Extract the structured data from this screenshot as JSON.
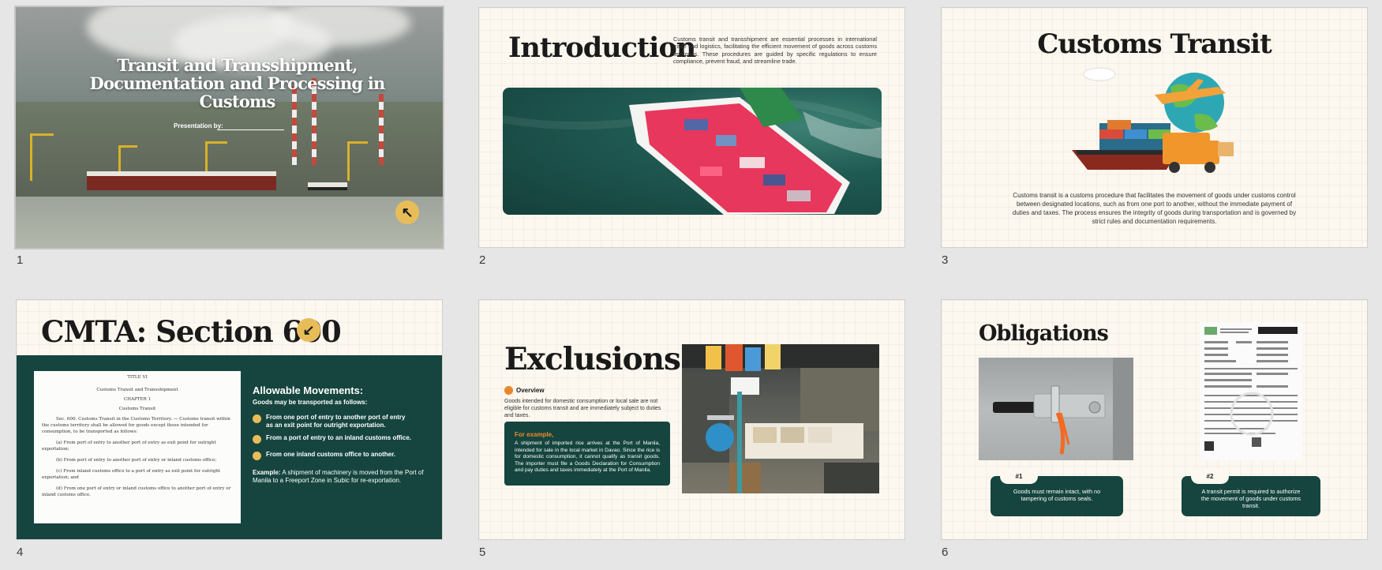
{
  "slides": [
    {
      "number": "1",
      "title": "Transit and Transshipment, Documentation and Processing in Customs",
      "presented_by": "Presentation by:",
      "icon": "arrow-up-left-icon"
    },
    {
      "number": "2",
      "title": "Introduction",
      "body": "Customs transit and transshipment are essential processes in international trade and logistics, facilitating the efficient movement of goods across customs territories. These procedures are guided by specific regulations to ensure compliance, prevent fraud, and streamline trade."
    },
    {
      "number": "3",
      "title": "Customs Transit",
      "body": "Customs transit is a customs procedure that facilitates the movement of goods under customs control between designated locations, such as from one port to another, without the immediate payment of duties and taxes. The process ensures the integrity of goods during transportation and is governed by strict rules and documentation requirements."
    },
    {
      "number": "4",
      "title": "CMTA: Section 600",
      "icon": "arrow-down-left-icon",
      "doc": {
        "title": "TITLE VI",
        "subtitle": "Customs Transit and Transshipment",
        "chapter": "CHAPTER 1",
        "chapter_name": "Customs Transit",
        "sec": "Sec. 600. Customs Transit in the Customs Territory. — Customs transit within the customs territory shall be allowed for goods except those intended for consumption, to be transported as follows:",
        "a": "(a) From port of entry to another port of entry as exit point for outright exportation;",
        "b": "(b) From port of entry to another port of entry or inland customs office;",
        "c": "(c) From inland customs office to a port of entry as exit point for outright exportation; and",
        "d": "(d) From one port of entry or inland customs office to another port of entry or inland customs office."
      },
      "heading": "Allowable Movements:",
      "subheading": "Goods may be transported as follows:",
      "items": [
        "From one port of entry to another port of entry as an exit point for outright exportation.",
        "From a port of entry to an inland customs office.",
        "From one inland customs office to another."
      ],
      "example_label": "Example:",
      "example_text": " A shipment of machinery is moved from the Port of Manila to a Freeport Zone in Subic for re-exportation."
    },
    {
      "number": "5",
      "title": "Exclusions",
      "overview_label": "Overview",
      "overview_text": "Goods intended for domestic consumption or local sale are not eligible for customs transit and are immediately subject to duties and taxes.",
      "example_label": "For example,",
      "example_text": "A shipment of imported rice arrives at the Port of Manila, intended for sale in the local market in Davao. Since the rice is for domestic consumption, it cannot qualify as transit goods. The importer must file a Goods Declaration for Consumption and pay duties and taxes immediately at the Port of Manila."
    },
    {
      "number": "6",
      "title": "Obligations",
      "cards": [
        {
          "badge": "#1",
          "text": "Goods must remain intact, with no tampering of customs seals."
        },
        {
          "badge": "#2",
          "text": "A transit permit is required to authorize the movement of goods under customs transit."
        }
      ]
    }
  ],
  "colors": {
    "background": "#e6e6e6",
    "cream": "#fcf7ef",
    "dark_green": "#15453e",
    "gold": "#e8bd59",
    "orange": "#f08a2d"
  }
}
